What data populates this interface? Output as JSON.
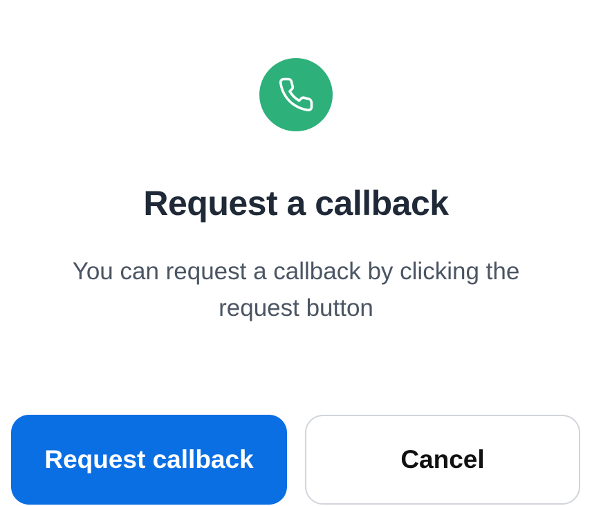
{
  "dialog": {
    "icon": "phone-icon",
    "title": "Request a callback",
    "description": "You can request a callback by clicking the request button",
    "primary_button_label": "Request callback",
    "secondary_button_label": "Cancel"
  },
  "colors": {
    "icon_background": "#2DB07A",
    "primary_button": "#0B6FE4",
    "title": "#1F2937",
    "description": "#4B5563"
  }
}
